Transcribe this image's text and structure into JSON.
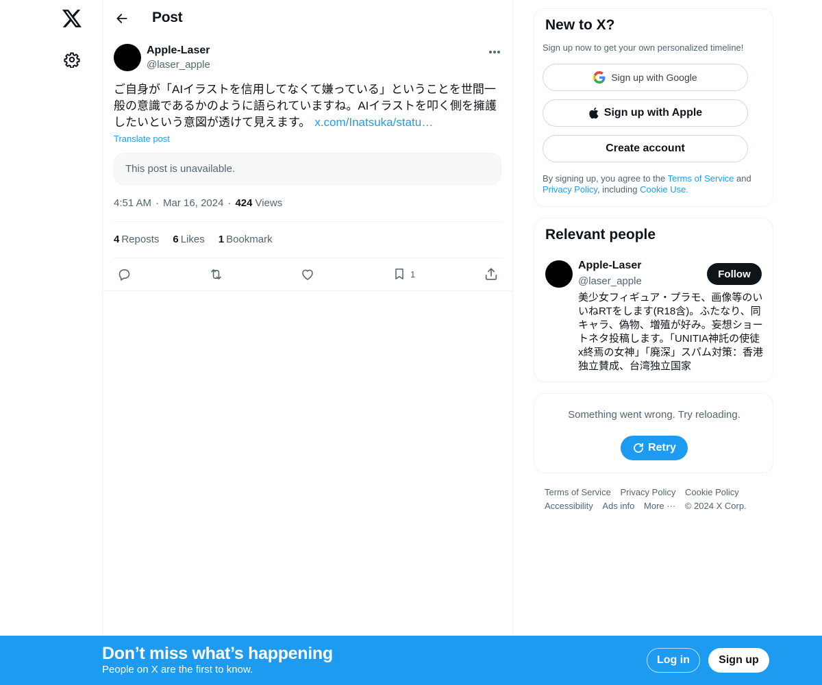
{
  "header": {
    "title": "Post"
  },
  "post": {
    "author_name": "Apple-Laser",
    "author_handle": "@laser_apple",
    "text": "ご自身が「AIイラストを信用してなくて嫌っている」ということを世間一般の意識であるかのように語られていますね。AIイラストを叩く側を擁護したいという意図が透けて見えます。",
    "link": "x.com/Inatsuka/statu…",
    "translate_label": "Translate post",
    "quoted_unavailable": "This post is unavailable.",
    "time": "4:51 AM",
    "date": "Mar 16, 2024",
    "views_count": "424",
    "views_label": "Views",
    "reposts_count": "4",
    "reposts_label": "Reposts",
    "likes_count": "6",
    "likes_label": "Likes",
    "bookmarks_count": "1",
    "bookmarks_label": "Bookmark",
    "bookmark_action_count": "1"
  },
  "signup_card": {
    "title": "New to X?",
    "subtitle": "Sign up now to get your own personalized timeline!",
    "google_label": "Sign up with Google",
    "apple_label": "Sign up with Apple",
    "create_label": "Create account",
    "legal_prefix": "By signing up, you agree to the ",
    "terms_link": "Terms of Service",
    "legal_and": " and ",
    "privacy_link": "Privacy Policy",
    "legal_including": ", including ",
    "cookie_link": "Cookie Use."
  },
  "relevant_people": {
    "title": "Relevant people",
    "name": "Apple-Laser",
    "handle": "@laser_apple",
    "follow_label": "Follow",
    "bio": "美少女フィギュア・プラモ、画像等のいいねRTをします(R18含)。ふたなり、同キャラ、偽物、増殖が好み。妄想ショートネタ投稿します。「UNITIA神託の使徒x終焉の女神」「廃深」スパム対策：香港独立賛成、台湾独立国家"
  },
  "error_card": {
    "message": "Something went wrong. Try reloading.",
    "retry_label": "Retry"
  },
  "footer": {
    "terms": "Terms of Service",
    "privacy": "Privacy Policy",
    "cookie": "Cookie Policy",
    "accessibility": "Accessibility",
    "ads": "Ads info",
    "more": "More ···",
    "copyright": "© 2024 X Corp."
  },
  "banner": {
    "title": "Don’t miss what’s happening",
    "subtitle": "People on X are the first to know.",
    "login_label": "Log in",
    "signup_label": "Sign up"
  },
  "colors": {
    "accent": "#1d9bf0",
    "text_primary": "#0f1419",
    "text_secondary": "#536471",
    "border": "#eff3f4"
  },
  "icons": {
    "logo": "x-logo-icon",
    "settings": "gear-icon",
    "back": "arrow-left-icon",
    "more": "more-horizontal-icon",
    "reply": "reply-icon",
    "repost": "repost-icon",
    "like": "heart-icon",
    "bookmark": "bookmark-icon",
    "share": "share-icon",
    "google": "google-icon",
    "apple": "apple-icon",
    "retry": "refresh-icon"
  }
}
